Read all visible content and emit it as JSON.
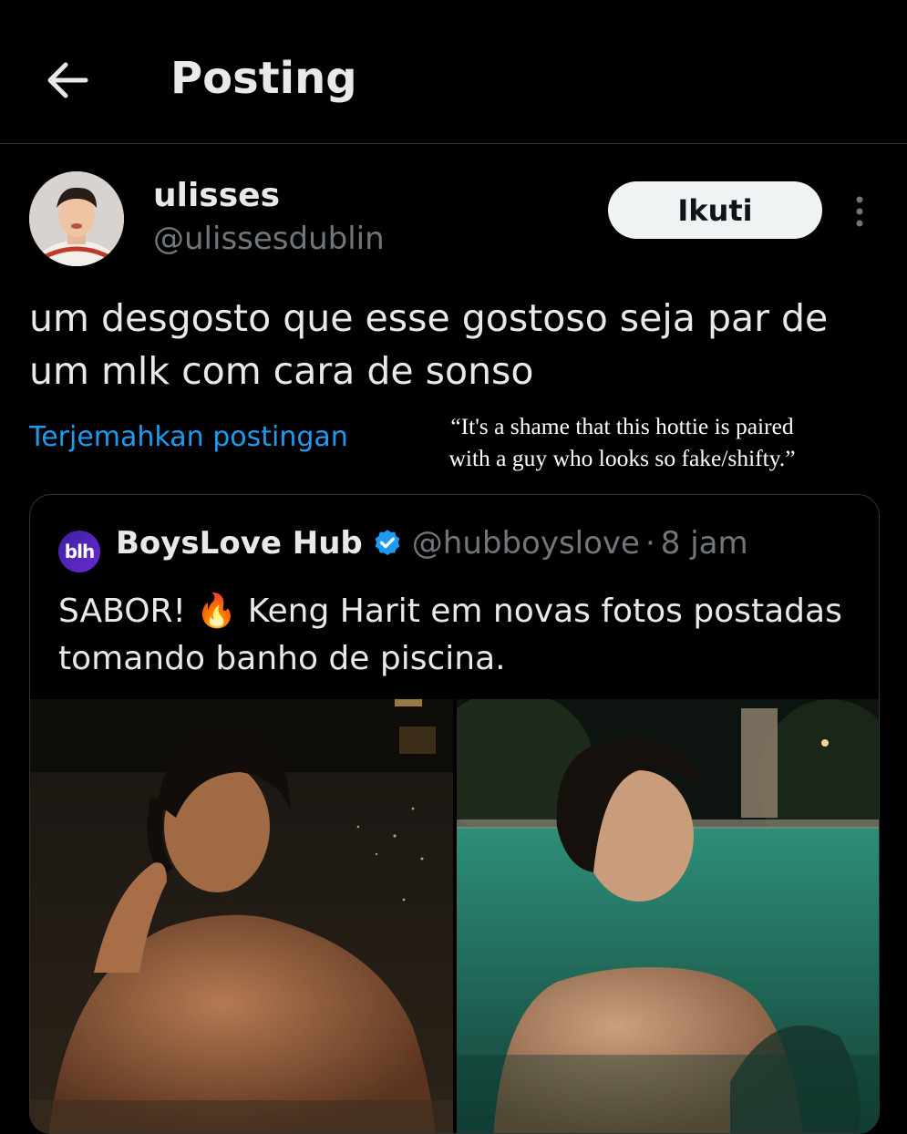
{
  "header": {
    "title": "Posting",
    "back_icon": "arrow-left-icon"
  },
  "post": {
    "author": {
      "display_name": "ulisses",
      "handle": "@ulissesdublin"
    },
    "follow_label": "Ikuti",
    "text": "um desgosto que esse gostoso seja par de um mlk com cara de sonso",
    "translate_label": "Terjemahkan postingan"
  },
  "caption_overlay": {
    "text": "“It's a shame that this hottie is paired with a guy who looks so fake/shifty.”"
  },
  "quoted_post": {
    "avatar_text": "blh",
    "display_name": "BoysLove Hub",
    "handle": "@hubboyslove",
    "separator": "·",
    "time": "8 jam",
    "text": "SABOR! 🔥 Keng Harit em novas fotos postadas tomando banho de piscina."
  },
  "colors": {
    "background": "#000000",
    "text": "#e7e9ea",
    "secondary_text": "#71767b",
    "link": "#1d9bf0",
    "verified": "#1d9bf0",
    "follow_button_bg": "#eff3f4"
  }
}
